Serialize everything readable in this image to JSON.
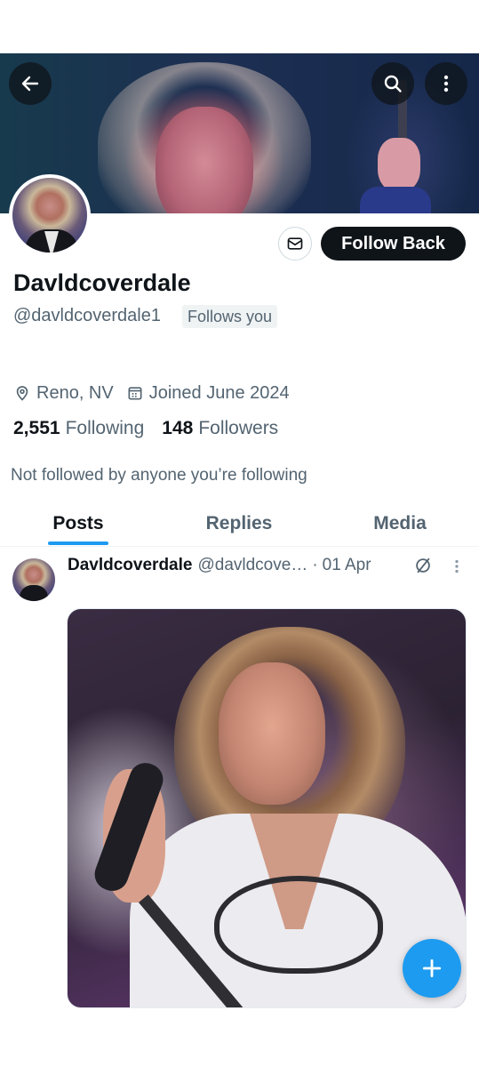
{
  "profile": {
    "display_name": "Davldcoverdale",
    "handle": "@davldcoverdale1",
    "follows_you_badge": "Follows you",
    "location": "Reno, NV",
    "joined": "Joined June 2024",
    "following_count": "2,551",
    "following_label": "Following",
    "followers_count": "148",
    "followers_label": "Followers",
    "social_context": "Not followed by anyone you’re following"
  },
  "actions": {
    "follow_back_label": "Follow Back"
  },
  "tabs": [
    {
      "label": "Posts",
      "active": true
    },
    {
      "label": "Replies",
      "active": false
    },
    {
      "label": "Media",
      "active": false
    }
  ],
  "post": {
    "name": "Davldcoverdale",
    "handle": "@davldcove…",
    "separator": "·",
    "date": "01 Apr"
  },
  "icons": {
    "back": "arrow-left-icon",
    "search": "search-icon",
    "more": "more-vertical-icon",
    "message": "envelope-icon",
    "location": "location-pin-icon",
    "calendar": "calendar-icon",
    "grok": "grok-icon",
    "compose": "plus-icon"
  },
  "colors": {
    "accent": "#1d9bf0",
    "text_primary": "#0f1419",
    "text_secondary": "#536471"
  }
}
